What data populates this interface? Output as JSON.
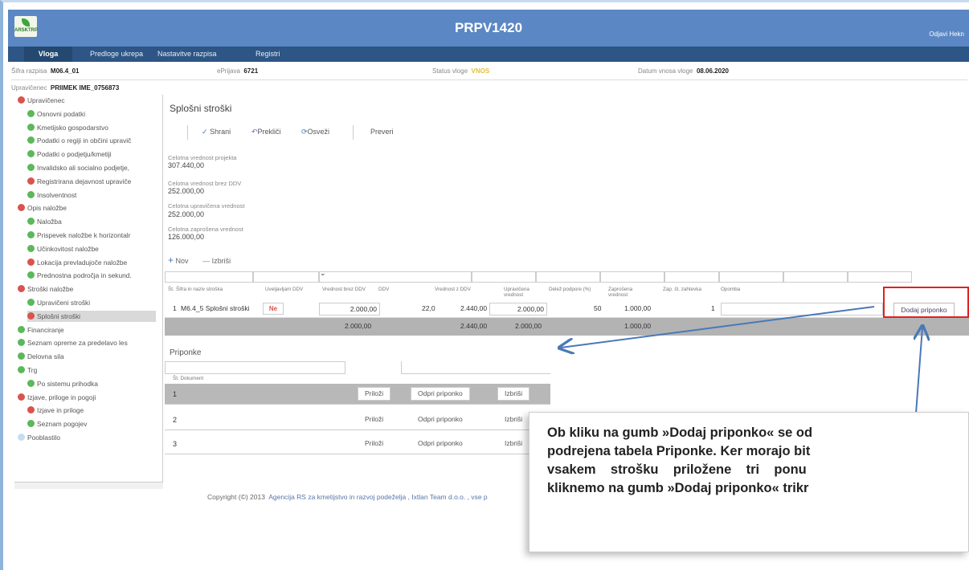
{
  "header": {
    "app_title": "PRPV1420",
    "logo_text": "ARSKTRP",
    "logout": "Odjavi Hekn"
  },
  "nav": {
    "items": [
      "Vloga",
      "Predloge ukrepa",
      "Nastavitve razpisa",
      "Registri"
    ]
  },
  "info": {
    "sifra_label": "Šifra razpisa",
    "sifra_value": "M06.4_01",
    "eprijava_label": "ePrijava",
    "eprijava_value": "6721",
    "status_label": "Status vloge",
    "status_value": "VNOS",
    "datum_label": "Datum vnosa vloge",
    "datum_value": "08.06.2020",
    "upravicenec_label": "Upravičenec",
    "upravicenec_value": "PRIIMEK IME_0756873"
  },
  "sidebar": {
    "items": [
      {
        "label": "Upravičenec",
        "status": "red"
      },
      {
        "label": "Osnovni podatki",
        "status": "green"
      },
      {
        "label": "Kmetijsko gospodarstvo",
        "status": "green"
      },
      {
        "label": "Podatki o regiji in občini upravič",
        "status": "green"
      },
      {
        "label": "Podatki o podjetju/kmetiji",
        "status": "green"
      },
      {
        "label": "Invalidsko ali socialno podjetje,",
        "status": "green"
      },
      {
        "label": "Registrirana dejavnost upraviče",
        "status": "red"
      },
      {
        "label": "Insolventnost",
        "status": "green"
      },
      {
        "label": "Opis naložbe",
        "status": "red"
      },
      {
        "label": "Naložba",
        "status": "green"
      },
      {
        "label": "Prispevek naložbe k horizontalr",
        "status": "green"
      },
      {
        "label": "Učinkovitost naložbe",
        "status": "green"
      },
      {
        "label": "Lokacija prevladujoče naložbe",
        "status": "red"
      },
      {
        "label": "Prednostna področja in sekund.",
        "status": "green"
      },
      {
        "label": "Stroški naložbe",
        "status": "red"
      },
      {
        "label": "Upravičeni stroški",
        "status": "green"
      },
      {
        "label": "Splošni stroški",
        "status": "red"
      },
      {
        "label": "Financiranje",
        "status": "green"
      },
      {
        "label": "Seznam opreme za predelavo les",
        "status": "green"
      },
      {
        "label": "Delovna sila",
        "status": "green"
      },
      {
        "label": "Trg",
        "status": "green"
      },
      {
        "label": "Po sistemu prihodka",
        "status": "green"
      },
      {
        "label": "Izjave, priloge in pogoji",
        "status": "red"
      },
      {
        "label": "Izjave in priloge",
        "status": "red"
      },
      {
        "label": "Seznam pogojev",
        "status": "green"
      },
      {
        "label": "Pooblastilo",
        "status": "lblue"
      }
    ]
  },
  "main": {
    "title": "Splošni stroški",
    "toolbar": {
      "save": "Shrani",
      "cancel": "Prekliči",
      "refresh": "Osveži",
      "check": "Preveri"
    },
    "fields": [
      {
        "label": "Celotna vrednost projekta",
        "value": "307.440,00"
      },
      {
        "label": "Celotna vrednost brez DDV",
        "value": "252.000,00"
      },
      {
        "label": "Celotna upravičena vrednost",
        "value": "252.000,00"
      },
      {
        "label": "Celotna zaprošena vrednost",
        "value": "126.000,00"
      }
    ],
    "grid_actions": {
      "new": "Nov",
      "delete": "Izbriši"
    },
    "columns": [
      "Št.",
      "Šifra in naziv stroška",
      "Uveljavljam DDV",
      "Vrednost brez DDV",
      "DDV",
      "Vrednost z DDV",
      "Upravičena vrednost",
      "Delež podpore (%)",
      "Zaprošena vrednost",
      "Zap. št. zahtevka",
      "Opomba"
    ],
    "row": {
      "num": "1",
      "naziv": "M6.4_5 Splošni stroški",
      "ddv_flag": "Ne",
      "vrednost_brez": "2.000,00",
      "ddv": "22,0",
      "vrednost_z": "2.440,00",
      "upravicena": "2.000,00",
      "delez": "50",
      "zaprosena": "1.000,00",
      "zahtevek": "1"
    },
    "totals": {
      "brez": "2.000,00",
      "z": "2.440,00",
      "upravicena": "2.000,00",
      "zaprosena": "1.000,00"
    },
    "add_attachment_btn": "Dodaj priponko"
  },
  "attachments": {
    "title": "Priponke",
    "header": "Št. Dokument",
    "rows": [
      {
        "num": "1",
        "attach": "Priloži",
        "open": "Odpri priponko",
        "delete": "Izbriši"
      },
      {
        "num": "2",
        "attach": "Priloži",
        "open": "Odpri priponko",
        "delete": "Izbriši"
      },
      {
        "num": "3",
        "attach": "Priloži",
        "open": "Odpri priponko",
        "delete": "Izbriši"
      }
    ]
  },
  "footer": {
    "prefix": "Copyright (©) 2013",
    "link": "Agencija RS za kmetijstvo in razvoj podeželja , Ixtlan Team d.o.o. , vse p"
  },
  "callout": {
    "lines": [
      "Ob kliku na gumb »Dodaj priponko« se od",
      "podrejena tabela Priponke. Ker morajo bit",
      "vsakem    strošku    priložene    tri    ponu",
      "kliknemo na gumb »Dodaj priponko« trikr"
    ]
  },
  "colors": {
    "header": "#5b87c4",
    "nav": "#2d5585",
    "status_vnos": "#e0c040",
    "highlight": "#e02020",
    "arrow": "#4a78b8"
  }
}
